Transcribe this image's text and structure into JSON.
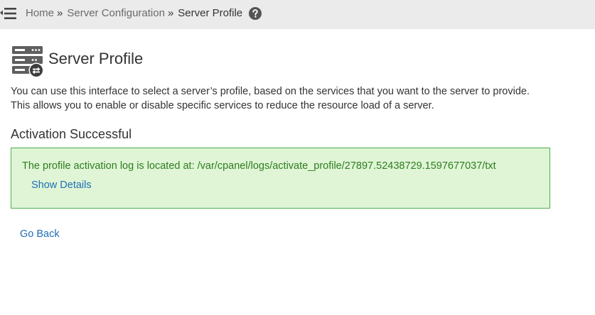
{
  "breadcrumb": {
    "items": [
      "Home",
      "Server Configuration",
      "Server Profile"
    ],
    "separator": "»"
  },
  "page": {
    "title": "Server Profile",
    "intro_line1": "You can use this interface to select a server’s profile, based on the services that you want to the server to provide.",
    "intro_line2": "This allows you to enable or disable specific services to reduce the resource load of a server."
  },
  "status": {
    "heading": "Activation Successful",
    "message": "The profile activation log is located at: /var/cpanel/logs/activate_profile/27897.52438729.1597677037/txt",
    "details_link": "Show Details"
  },
  "actions": {
    "go_back": "Go Back"
  },
  "icons": {
    "menu": "menu-toggle-icon",
    "help": "help-icon",
    "page": "server-profile-icon"
  },
  "colors": {
    "topbar": "#ebebeb",
    "success_bg": "#dff5d6",
    "success_border": "#4cae4c",
    "success_text": "#2e7d1e",
    "link": "#1f6fb5"
  }
}
